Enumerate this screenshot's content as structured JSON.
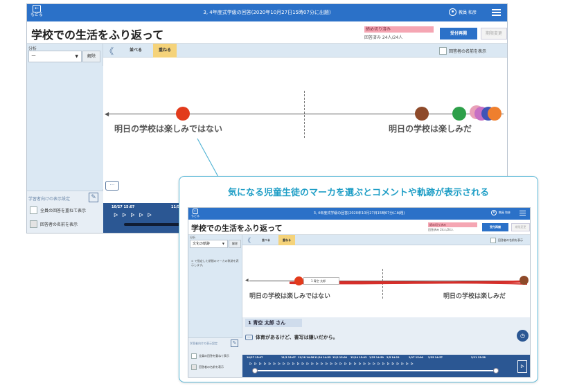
{
  "app": {
    "back_label": "もどる",
    "title": "3, 4年度式学級の回答(2020年10月27日15時07分に出題)",
    "user": "教員 和彦"
  },
  "question": {
    "title": "学校での生活をふり返って",
    "deadline": "締め切り済み",
    "submitted": "回答済み 24人/24人",
    "reopen_label": "受付再開",
    "change_label": "期限変更"
  },
  "sidebar": {
    "analysis_label": "分析",
    "analysis_value": "ー",
    "clear_label": "解除",
    "learner_settings_label": "学習者向けの表示設定",
    "overlay_all_label": "全員の回答を重ねて表示",
    "show_names_label": "回答者の名前を表示"
  },
  "toolbar": {
    "arrange_label": "並べる",
    "overlay_label": "重ねる",
    "show_names_label": "回答者の名前を表示"
  },
  "axis": {
    "left_label": "明日の学校は楽しみではない",
    "right_label": "明日の学校は楽しみだ"
  },
  "markers": {
    "colors": [
      "#e23b1c",
      "#8e4a2a",
      "#2ea04a",
      "#e9a0b8",
      "#c66fc4",
      "#3f54b6",
      "#ef7f2e"
    ]
  },
  "timeline": {
    "dates": [
      "10/27 15:07",
      "11/5"
    ],
    "flags": "ᐅᐅᐅᐅᐅ"
  },
  "callout": {
    "text": "気になる児童生徒のマーカを選ぶとコメントや軌跡が表示される"
  },
  "inner": {
    "analysis_value": "文化の軌跡",
    "note": "⊙ で指定した期間のマーカの軌跡を表示します。",
    "tag": "1 青空 太郎",
    "student_name": "1 青空 太郎 さん",
    "comment": "体育があるけど、書写は嫌いだから。",
    "timeline_dates": [
      "10/27 15:07",
      "11/3 15:07",
      "11/18 14:58",
      "11/24 14:55",
      "12/2 15:00",
      "12/14 15:03",
      "1/25 14:59",
      "2/5 14:22",
      "2/17 15:00",
      "2/25 14:57",
      "3/11 15:58"
    ],
    "flags": "ᐅᐅᐅᐅᐅᐅᐅᐅᐅᐅᐅᐅᐅᐅᐅᐅᐅᐅᐅᐅᐅᐅᐅᐅᐅᐅᐅᐅᐅᐅᐅᐅᐅᐅᐅ"
  }
}
